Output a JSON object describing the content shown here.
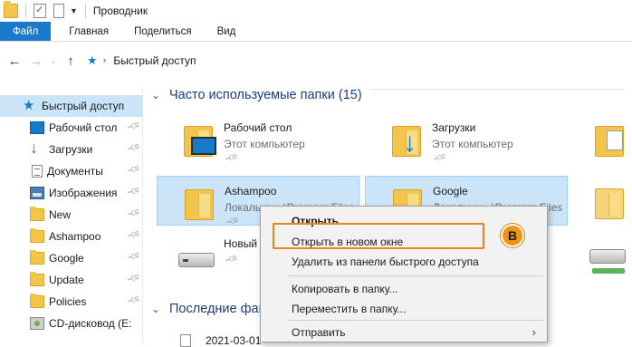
{
  "window": {
    "title": "Проводник"
  },
  "ribbon": {
    "tabs": [
      "Файл",
      "Главная",
      "Поделиться",
      "Вид"
    ]
  },
  "address": {
    "location": "Быстрый доступ"
  },
  "sidebar": {
    "items": [
      {
        "label": "Быстрый доступ",
        "icon": "quick-access-star-icon"
      },
      {
        "label": "Рабочий стол",
        "icon": "desktop-icon",
        "pinned": true
      },
      {
        "label": "Загрузки",
        "icon": "download-icon",
        "pinned": true
      },
      {
        "label": "Документы",
        "icon": "document-icon",
        "pinned": true
      },
      {
        "label": "Изображения",
        "icon": "pictures-icon",
        "pinned": true
      },
      {
        "label": "New",
        "icon": "folder-icon",
        "pinned": true
      },
      {
        "label": "Ashampoo",
        "icon": "folder-icon",
        "pinned": true
      },
      {
        "label": "Google",
        "icon": "folder-icon",
        "pinned": true
      },
      {
        "label": "Update",
        "icon": "folder-icon",
        "pinned": true
      },
      {
        "label": "Policies",
        "icon": "folder-icon",
        "pinned": true
      },
      {
        "label": "CD-дисковод (E:",
        "icon": "cd-drive-icon"
      }
    ]
  },
  "main": {
    "frequent_title": "Часто используемые папки (15)",
    "recent_title": "Последние фай",
    "recent_first": "2021-03-01",
    "tiles": [
      {
        "name": "Рабочий стол",
        "sub": "Этот компьютер",
        "icon": "desktop-folder-icon"
      },
      {
        "name": "Загрузки",
        "sub": "Этот компьютер",
        "icon": "downloads-folder-icon"
      },
      {
        "name": "Ashampoo",
        "sub": "Локальны...\\Program Files",
        "icon": "folder-icon"
      },
      {
        "name": "Google",
        "sub": "Локальны...\\Program Files",
        "icon": "folder-icon"
      },
      {
        "name": "Новый",
        "sub": "",
        "icon": "drive-icon"
      }
    ]
  },
  "context_menu": {
    "items": [
      "Открыть",
      "Открыть в новом окне",
      "Удалить из панели быстрого доступа",
      "Копировать в папку...",
      "Переместить в папку...",
      "Отправить"
    ],
    "callout_label": "B",
    "accent_color": "#e8861a"
  },
  "colors": {
    "accent": "#1979ca",
    "selection": "#cce4f7"
  }
}
